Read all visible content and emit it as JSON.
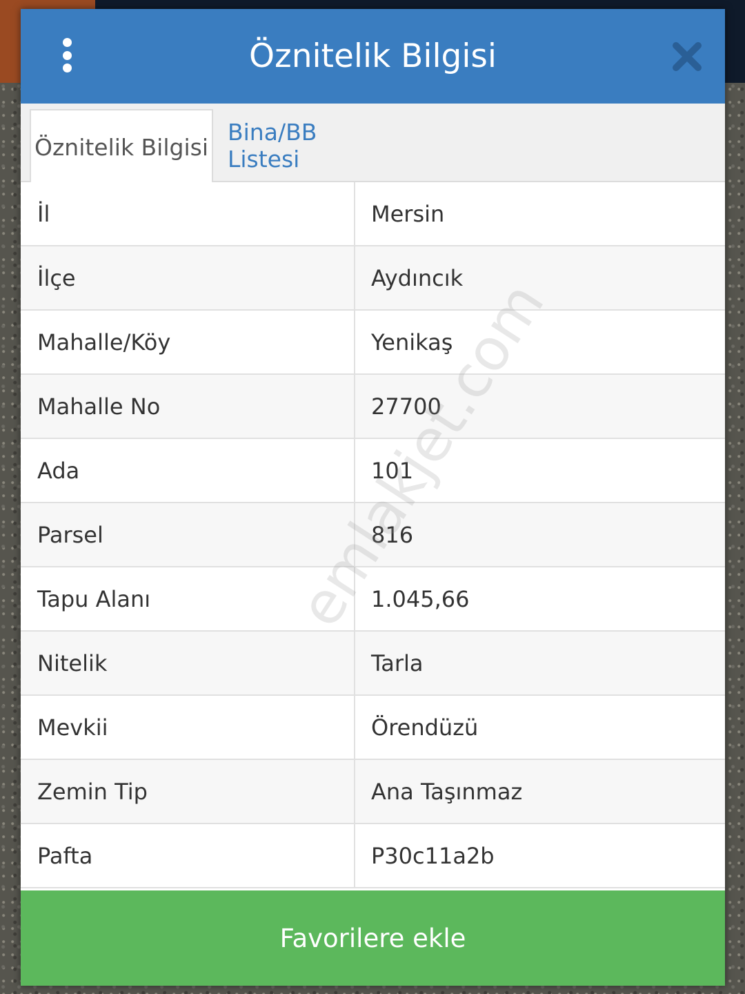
{
  "dialog": {
    "title": "Öznitelik Bilgisi",
    "menu_icon": "more-vertical-icon",
    "close_icon": "close-icon",
    "header_color": "#3a7dc0"
  },
  "tabs": [
    {
      "label": "Öznitelik Bilgisi",
      "active": true
    },
    {
      "label": "Bina/BB Listesi",
      "active": false
    }
  ],
  "attributes": [
    {
      "label": "İl",
      "value": "Mersin"
    },
    {
      "label": "İlçe",
      "value": "Aydıncık"
    },
    {
      "label": "Mahalle/Köy",
      "value": "Yenikaş"
    },
    {
      "label": "Mahalle No",
      "value": "27700"
    },
    {
      "label": "Ada",
      "value": "101"
    },
    {
      "label": "Parsel",
      "value": "816"
    },
    {
      "label": "Tapu Alanı",
      "value": "1.045,66"
    },
    {
      "label": "Nitelik",
      "value": "Tarla"
    },
    {
      "label": "Mevkii",
      "value": "Örendüzü"
    },
    {
      "label": "Zemin Tip",
      "value": "Ana Taşınmaz"
    },
    {
      "label": "Pafta",
      "value": "P30c11a2b"
    }
  ],
  "footer": {
    "favorite_label": "Favorilere ekle",
    "button_color": "#5cb85c"
  },
  "watermark": "emlakjet.com"
}
